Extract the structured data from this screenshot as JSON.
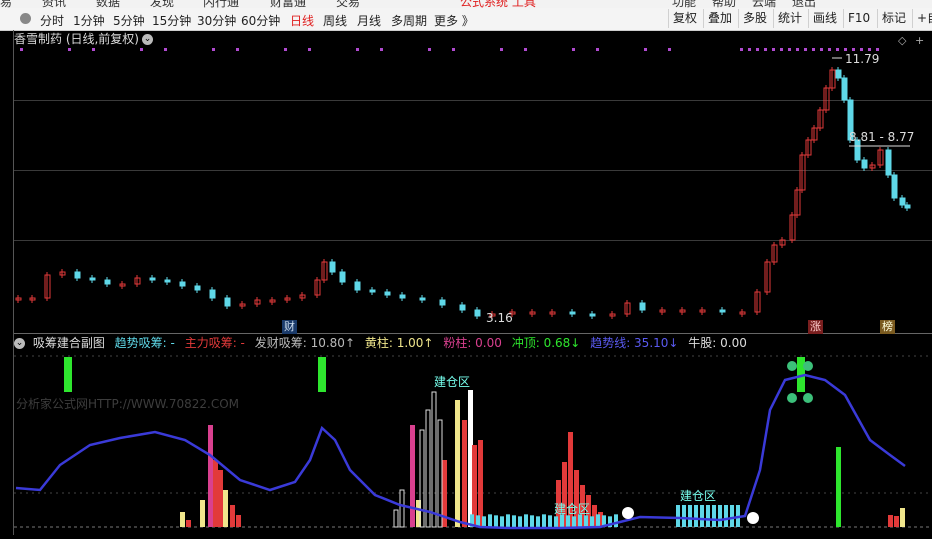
{
  "menu": {
    "items": [
      "易",
      "资讯",
      "数据",
      "发现",
      "内行通",
      "财富通",
      "交易",
      "公式系统 工具",
      "功能",
      "帮助",
      "云端",
      "退出"
    ]
  },
  "periods": [
    "分时",
    "1分钟",
    "5分钟",
    "15分钟",
    "30分钟",
    "60分钟",
    "日线",
    "周线",
    "月线",
    "多周期",
    "更多 》"
  ],
  "active_period": "日线",
  "right_buttons": [
    "复权",
    "叠加",
    "多股",
    "统计",
    "画线",
    "F10",
    "标记",
    "+自"
  ],
  "stock": {
    "title": "香雪制药 (日线,前复权)"
  },
  "price_labels": {
    "high": "11.79",
    "range": "8.81 - 8.77",
    "low": "3.16"
  },
  "markers": {
    "cai": "财",
    "zhang": "涨",
    "bang": "榜"
  },
  "indicator": {
    "name": "吸筹建合副图",
    "trend_label": "趋势吸筹: -",
    "main_label": "主力吸筹: -",
    "fa_label": "发财吸筹: 10.80↑",
    "yellow_label": "黄柱: 1.00↑",
    "pink_label": "粉柱: 0.00",
    "top_label": "冲顶: 0.68↓",
    "trendline_label": "趋势线: 35.10↓",
    "bull_label": "牛股: 0.00"
  },
  "zones": {
    "a": "建仓区",
    "b": "建仓区",
    "c": "建仓区"
  },
  "watermark": "分析家公式网HTTP://WWW.70822.COM",
  "colors": {
    "up": "#e23a3a",
    "down": "#5fd8e8",
    "trend": "#3a3ad8",
    "yellow": "#f0e68c",
    "pink": "#d9408f",
    "green": "#2ee62e"
  }
}
